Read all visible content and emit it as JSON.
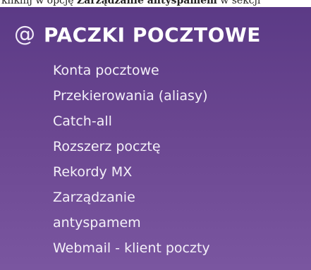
{
  "top_strip": {
    "text_before": "kliknij w opcję ",
    "text_bold": "Zarządzanie antyspamem",
    "text_after": " w sekcji"
  },
  "panel": {
    "icon": "at-icon",
    "icon_glyph": "@",
    "title": "PACZKI POCZTOWE",
    "background": "#6a4690",
    "text_color": "#ffffff"
  },
  "menu": {
    "items": [
      {
        "label": "Konta pocztowe"
      },
      {
        "label": "Przekierowania (aliasy)"
      },
      {
        "label": "Catch-all"
      },
      {
        "label": "Rozszerz pocztę"
      },
      {
        "label": "Rekordy MX"
      },
      {
        "label": "Zarządzanie"
      },
      {
        "label": "antyspamem"
      },
      {
        "label": "Webmail - klient poczty"
      }
    ]
  }
}
